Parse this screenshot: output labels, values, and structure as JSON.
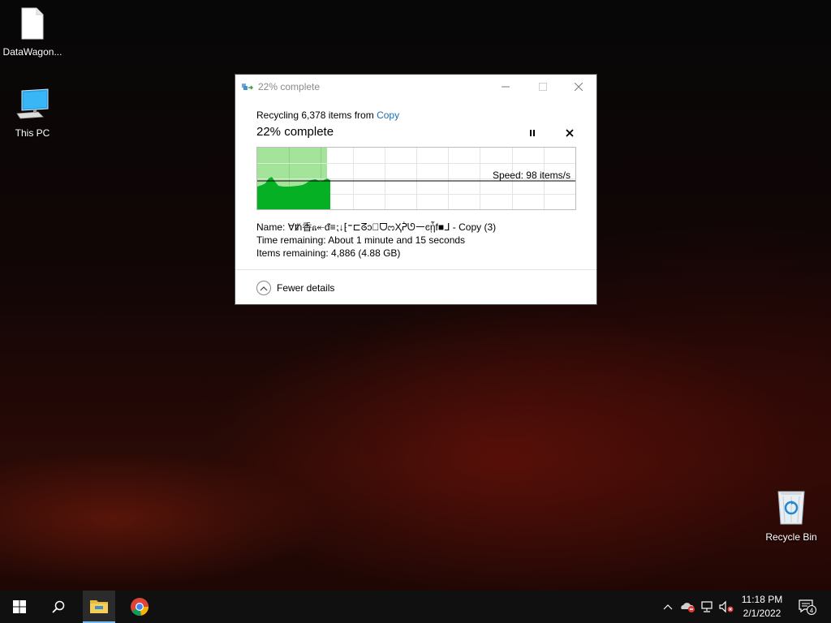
{
  "desktop": {
    "icons": [
      {
        "label": "DataWagon..."
      },
      {
        "label": "This PC"
      },
      {
        "label": "Recycle Bin"
      }
    ]
  },
  "dialog": {
    "title": "22% complete",
    "recycling_prefix": "Recycling 6,378 items from ",
    "recycling_link": "Copy",
    "progress_heading": "22% complete",
    "progress_percent": 22,
    "speed": "Speed: 98 items/s",
    "name_label": "Name:",
    "name_value": "∀ᵺ香ᏺ↞ᵭ≡⁏↓⁅⁼⊏ᘔↄ⃝ᗜᦂҲᕉᘎ㇐ͼᾗf■ᒧ - Copy (3)",
    "time_label": "Time remaining:",
    "time_value": "About 1 minute and 15 seconds",
    "items_label": "Items remaining:",
    "items_value": "4,886 (4.88 GB)",
    "fewer_details": "Fewer details",
    "colors": {
      "accent": "#1a6fb0",
      "graph_fill": "#06b025",
      "graph_bg": "#a4e39a"
    }
  },
  "taskbar": {
    "time": "11:18 PM",
    "date": "2/1/2022",
    "notification_count": "4",
    "icons": [
      "windows-start-icon",
      "search-icon",
      "file-explorer-icon",
      "chrome-icon",
      "chevron-up-icon",
      "onedrive-icon",
      "network-icon",
      "volume-icon",
      "action-center-icon"
    ]
  }
}
